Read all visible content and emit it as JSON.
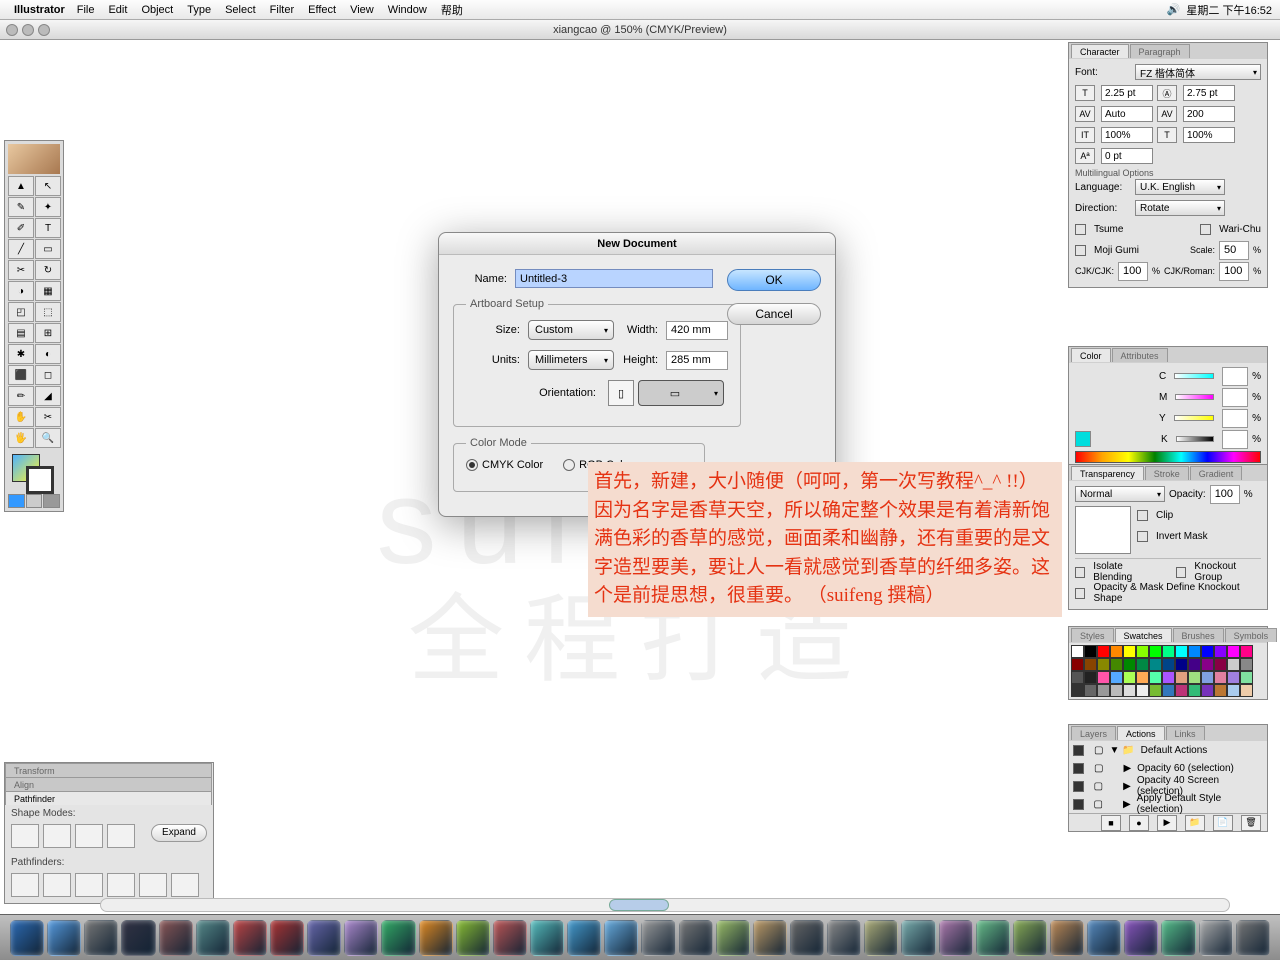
{
  "menubar": {
    "app": "Illustrator",
    "items": [
      "File",
      "Edit",
      "Object",
      "Type",
      "Select",
      "Filter",
      "Effect",
      "View",
      "Window",
      "帮助"
    ],
    "clock": "星期二 下午16:52"
  },
  "titlebar": {
    "title": "xiangcao @ 150% (CMYK/Preview)"
  },
  "watermark": {
    "line1": "suifeng",
    "line2": "全程打造"
  },
  "redtext": "首先，新建，大小随便（呵呵，第一次写教程^_^ !!）\n因为名字是香草天空，所以确定整个效果是有着清新饱满色彩的香草的感觉，画面柔和幽静，还有重要的是文字造型要美，要让人一看就感觉到香草的纤细多姿。这个是前提思想，很重要。\n（suifeng 撰稿）",
  "dialog": {
    "title": "New Document",
    "name_label": "Name:",
    "name_value": "Untitled-3",
    "artboard_legend": "Artboard Setup",
    "size_label": "Size:",
    "size_value": "Custom",
    "width_label": "Width:",
    "width_value": "420 mm",
    "units_label": "Units:",
    "units_value": "Millimeters",
    "height_label": "Height:",
    "height_value": "285 mm",
    "orientation_label": "Orientation:",
    "colormode_legend": "Color Mode",
    "cmyk_label": "CMYK Color",
    "rgb_label": "RGB Color",
    "ok": "OK",
    "cancel": "Cancel"
  },
  "char_panel": {
    "tab_character": "Character",
    "tab_paragraph": "Paragraph",
    "font_label": "Font:",
    "font_value": "FZ 楷体简体",
    "size": "2.25 pt",
    "leading": "2.75 pt",
    "kerning": "Auto",
    "tracking": "200",
    "vscale": "100%",
    "hscale": "100%",
    "baseline": "0 pt",
    "multi_label": "Multilingual Options",
    "lang_label": "Language:",
    "lang_value": "U.K. English",
    "dir_label": "Direction:",
    "dir_value": "Rotate",
    "tsume": "Tsume",
    "warichu": "Wari-Chu",
    "moji": "Moji Gumi",
    "scale_label": "Scale:",
    "scale_value": "50",
    "cjk_label": "CJK/CJK:",
    "cjk_value": "100",
    "cjk_roman_label": "CJK/Roman:",
    "cjk_roman_value": "100"
  },
  "color_panel": {
    "tab_color": "Color",
    "tab_attr": "Attributes",
    "c": "C",
    "m": "M",
    "y": "Y",
    "k": "K",
    "pct": "%"
  },
  "trans_panel": {
    "tab_trans": "Transparency",
    "tab_stroke": "Stroke",
    "tab_grad": "Gradient",
    "mode": "Normal",
    "opacity_label": "Opacity:",
    "opacity": "100",
    "pct": "%",
    "clip": "Clip",
    "invert": "Invert Mask",
    "isolate": "Isolate Blending",
    "knockout": "Knockout Group",
    "define": "Opacity & Mask Define Knockout Shape"
  },
  "swatch_panel": {
    "tab_styles": "Styles",
    "tab_swatches": "Swatches",
    "tab_brushes": "Brushes",
    "tab_symbols": "Symbols"
  },
  "actions_panel": {
    "tab_layers": "Layers",
    "tab_actions": "Actions",
    "tab_links": "Links",
    "default": "Default Actions",
    "a1": "Opacity 60 (selection)",
    "a2": "Opacity 40 Screen (selection)",
    "a3": "Apply Default Style (selection)"
  },
  "pathfinder": {
    "tab_transform": "Transform",
    "tab_align": "Align",
    "tab_pathfinder": "Pathfinder",
    "shape_modes": "Shape Modes:",
    "expand": "Expand",
    "pathfinders": "Pathfinders:"
  },
  "tools": [
    "▲",
    "↖",
    "✎",
    "✦",
    "✐",
    "T",
    "╱",
    "▭",
    "✂",
    "↻",
    "◑",
    "▦",
    "◰",
    "⬚",
    "▤",
    "⊞",
    "✱",
    "◐",
    "⬛",
    "◻",
    "✏",
    "◢",
    "✋",
    "✂",
    "🖐",
    "🔍"
  ]
}
